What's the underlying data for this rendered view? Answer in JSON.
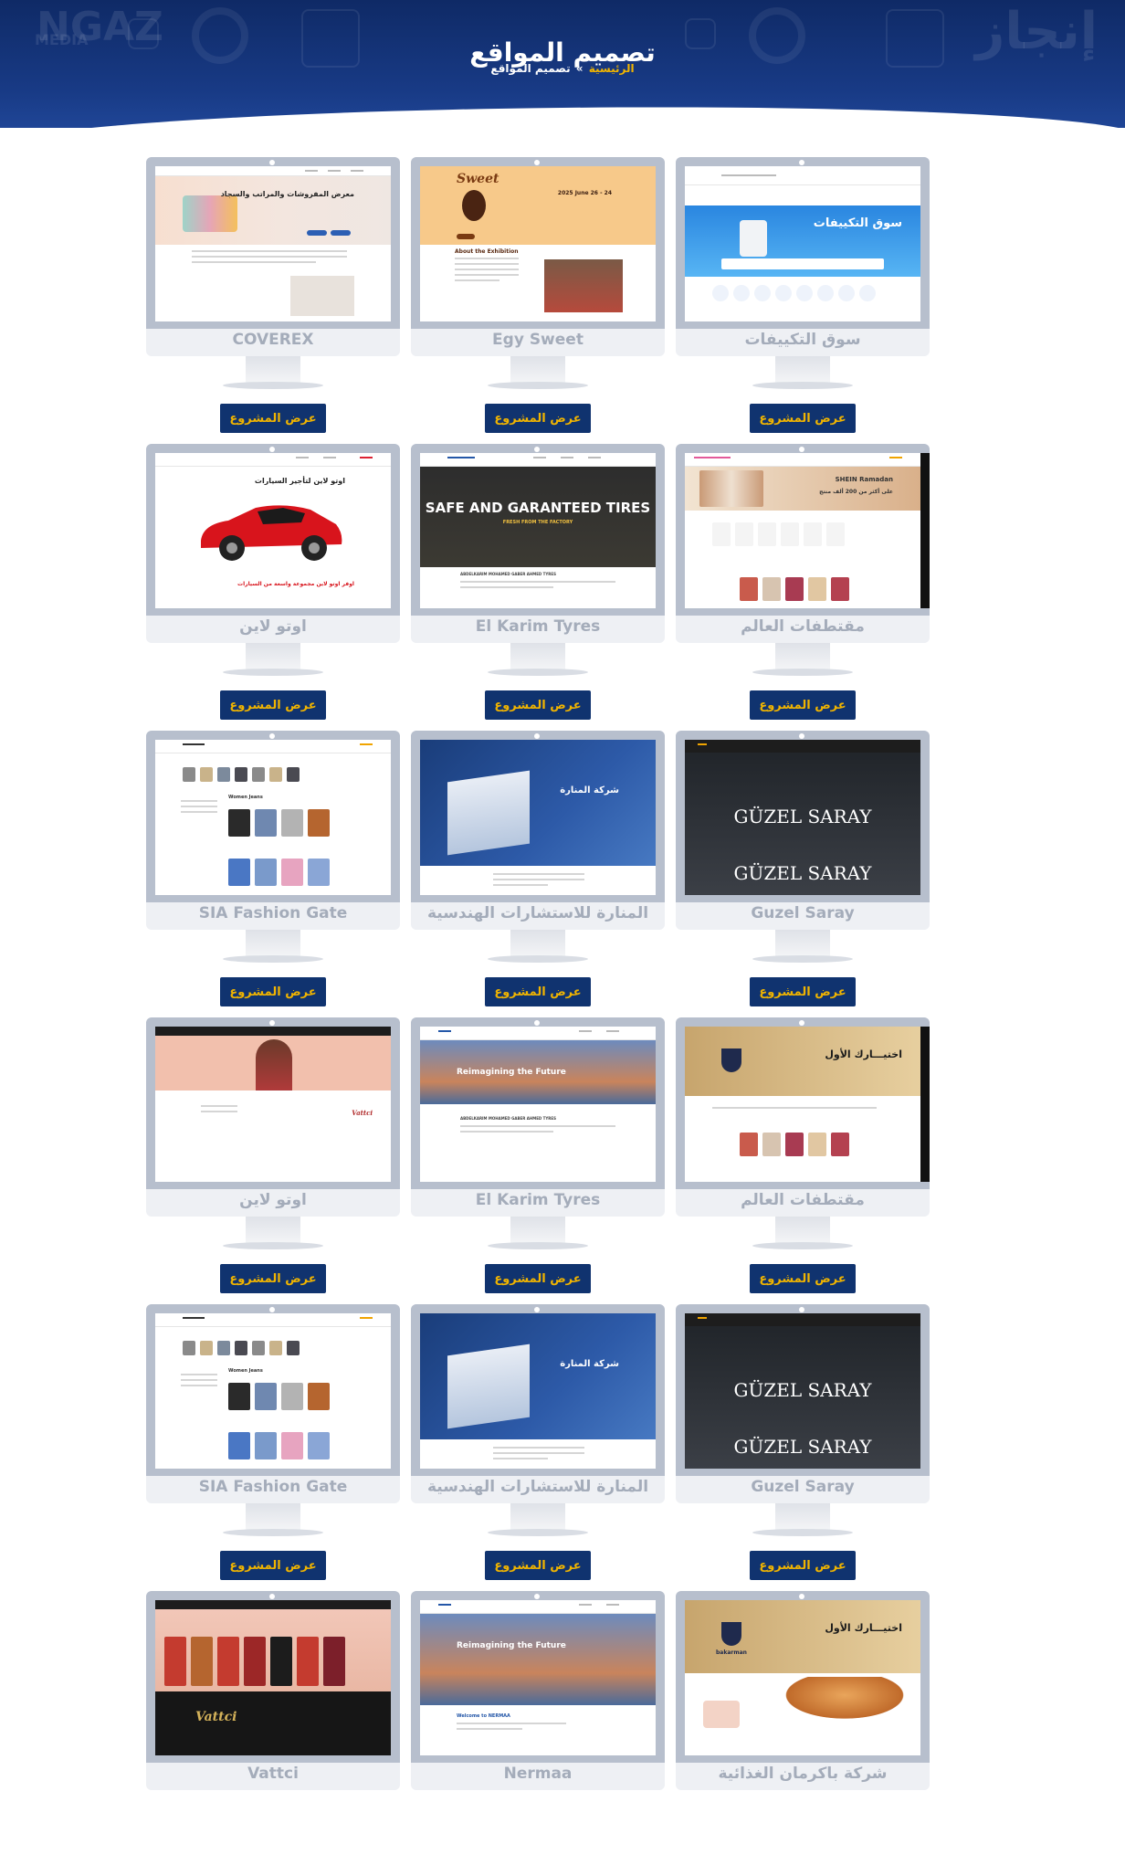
{
  "header": {
    "title": "تصميم المواقع",
    "breadcrumb": {
      "home": "الرئيسية",
      "separator": "»",
      "current": "تصميم المواقع"
    },
    "watermark": {
      "logo_ar": "إنجاز",
      "logo_en": "NGAZ",
      "media": "MEDIA"
    }
  },
  "button_label": "عرض المشروع",
  "projects": [
    {
      "name": "COVEREX",
      "screen": {
        "headline": "معرض المفروشات والمراتب والسجاد",
        "nav": [
          "عن الشركة",
          "المنتجات",
          "المعارض"
        ]
      }
    },
    {
      "name": "Egy Sweet",
      "screen": {
        "logo": "Sweet",
        "headline": "2025 June 26 - 24",
        "section": "About the Exhibition"
      }
    },
    {
      "name": "سوق التكييفات",
      "screen": {
        "headline": "سوق التكييفات"
      }
    },
    {
      "name": "مقتطفات العالم",
      "screen": {
        "headline": "SHEIN Ramadan",
        "sub": "على أكثر من 200 ألف منتج"
      }
    },
    {
      "name": "El Karim Tyres",
      "screen": {
        "headline": "SAFE AND GARANTEED TIRES",
        "sub": "FRESH FROM THE FACTORY",
        "caption": "ABDELKARIM MOHAMED GABER AHMED TYRES"
      }
    },
    {
      "name": "اوتو لاين",
      "screen": {
        "headline": "اوتو لاين لتأجير السيارات",
        "sub": "اوفر اوتو لاين مجموعة واسعة من السيارات"
      }
    },
    {
      "name": "Guzel Saray",
      "screen": {
        "headline": "GÜZEL SARAY",
        "headline2": "GÜZEL SARAY"
      }
    },
    {
      "name": "المنارة للاستشارات الهندسية",
      "screen": {
        "headline": "شركة المنارة"
      }
    },
    {
      "name": "SIA Fashion Gate",
      "screen": {
        "headline": "Women Jeans"
      }
    },
    {
      "name": "مقتطفات العالم",
      "screen": {
        "headline": "اختيـــارك الأول"
      }
    },
    {
      "name": "El Karim Tyres",
      "screen": {
        "headline": "Reimagining the Future",
        "caption": "ABDELKARIM MOHAMED GABER AHMED TYRES"
      }
    },
    {
      "name": "اوتو لاين",
      "screen": {
        "headline": "Vattci"
      }
    },
    {
      "name": "Guzel Saray",
      "screen": {
        "headline": "GÜZEL SARAY",
        "headline2": "GÜZEL SARAY"
      }
    },
    {
      "name": "المنارة للاستشارات الهندسية",
      "screen": {
        "headline": "شركة المنارة"
      }
    },
    {
      "name": "SIA Fashion Gate",
      "screen": {
        "headline": "Women Jeans"
      }
    },
    {
      "name": "شركة باكرمان الغذائية",
      "screen": {
        "headline": "اختيـــارك الأول",
        "brand": "bakarman"
      }
    },
    {
      "name": "Nermaa",
      "screen": {
        "headline": "Reimagining the Future",
        "sub": "Welcome to NERMAA"
      }
    },
    {
      "name": "Vattci",
      "screen": {
        "headline": "Vattci"
      }
    }
  ],
  "colors": {
    "header_bg": "#0f2a66",
    "button_bg": "#10336f",
    "button_text": "#f0b400",
    "bezel": "#b7bfcd",
    "label": "#a4acba"
  }
}
